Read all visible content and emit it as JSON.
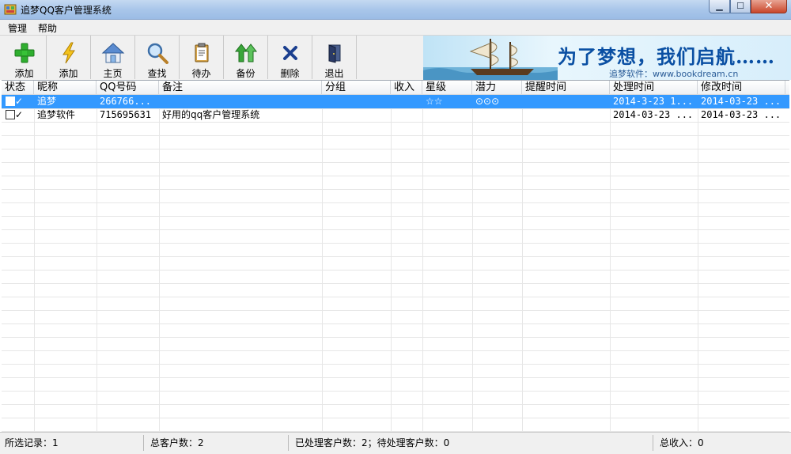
{
  "window": {
    "title": "追梦QQ客户管理系统"
  },
  "menu": [
    {
      "label": "管理"
    },
    {
      "label": "帮助"
    }
  ],
  "toolbar": [
    {
      "label": "添加",
      "icon": "plus-icon"
    },
    {
      "label": "添加",
      "icon": "lightning-icon"
    },
    {
      "label": "主页",
      "icon": "home-icon"
    },
    {
      "label": "查找",
      "icon": "search-icon"
    },
    {
      "label": "待办",
      "icon": "clipboard-icon"
    },
    {
      "label": "备份",
      "icon": "backup-arrows-icon"
    },
    {
      "label": "删除",
      "icon": "delete-x-icon"
    },
    {
      "label": "退出",
      "icon": "exit-door-icon"
    }
  ],
  "banner": {
    "title": "为了梦想，我们启航……",
    "subtitle": "追梦软件：www.bookdream.cn"
  },
  "table": {
    "columns": [
      "状态",
      "昵称",
      "QQ号码",
      "备注",
      "分组",
      "收入",
      "星级",
      "潜力",
      "提醒时间",
      "处理时间",
      "修改时间"
    ],
    "rows": [
      {
        "status": "✓",
        "nickname": "追梦",
        "qq": "266766...",
        "note": "",
        "group": "",
        "income": "",
        "stars": "☆☆",
        "potential": "⊙⊙⊙",
        "remind": "",
        "processed": "2014-3-23 1...",
        "modified": "2014-03-23 ...",
        "selected": true
      },
      {
        "status": "✓",
        "nickname": "追梦软件",
        "qq": "715695631",
        "note": "好用的qq客户管理系统",
        "group": "",
        "income": "",
        "stars": "",
        "potential": "",
        "remind": "",
        "processed": "2014-03-23 ...",
        "modified": "2014-03-23 ...",
        "selected": false
      }
    ]
  },
  "status": {
    "selected": "所选记录：1",
    "total": "总客户数：2",
    "processed": "已处理客户数：2；待处理客户数：0",
    "income": "总收入：0"
  },
  "colors": {
    "selection": "#3399ff",
    "banner_text": "#0a4fa3"
  }
}
